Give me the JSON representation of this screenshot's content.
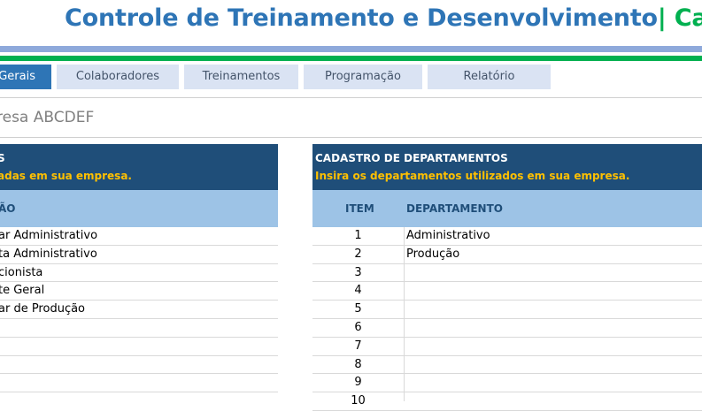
{
  "header": {
    "title": "Controle de Treinamento e Desenvolvimento",
    "separator": "|",
    "subtitle": " Cadastro"
  },
  "tabs": [
    {
      "label": "Gerais",
      "active": true
    },
    {
      "label": "Colaboradores",
      "active": false
    },
    {
      "label": "Treinamentos",
      "active": false
    },
    {
      "label": "Programação",
      "active": false
    },
    {
      "label": "Relatório",
      "active": false
    }
  ],
  "company": "resa ABCDEF",
  "left_panel": {
    "title": "S",
    "description": "adas em sua empresa.",
    "column": "ÃO",
    "rows": [
      "ar Administrativo",
      "ta Administrativo",
      "cionista",
      "te Geral",
      "ar de Produção",
      "",
      "",
      "",
      "",
      ""
    ]
  },
  "right_panel": {
    "title": "CADASTRO DE DEPARTAMENTOS",
    "description": "Insira os departamentos utilizados em sua empresa.",
    "col_item": "ITEM",
    "col_department": "DEPARTAMENTO",
    "items": [
      "1",
      "2",
      "3",
      "4",
      "5",
      "6",
      "7",
      "8",
      "9",
      "10"
    ],
    "departments": [
      "Administrativo",
      "Produção",
      "",
      "",
      "",
      "",
      "",
      "",
      "",
      ""
    ]
  },
  "colors": {
    "title_blue": "#2e75b6",
    "accent_green": "#00b050",
    "panel_dark": "#1f4e79",
    "panel_light": "#9dc3e6",
    "desc_yellow": "#ffc000"
  }
}
